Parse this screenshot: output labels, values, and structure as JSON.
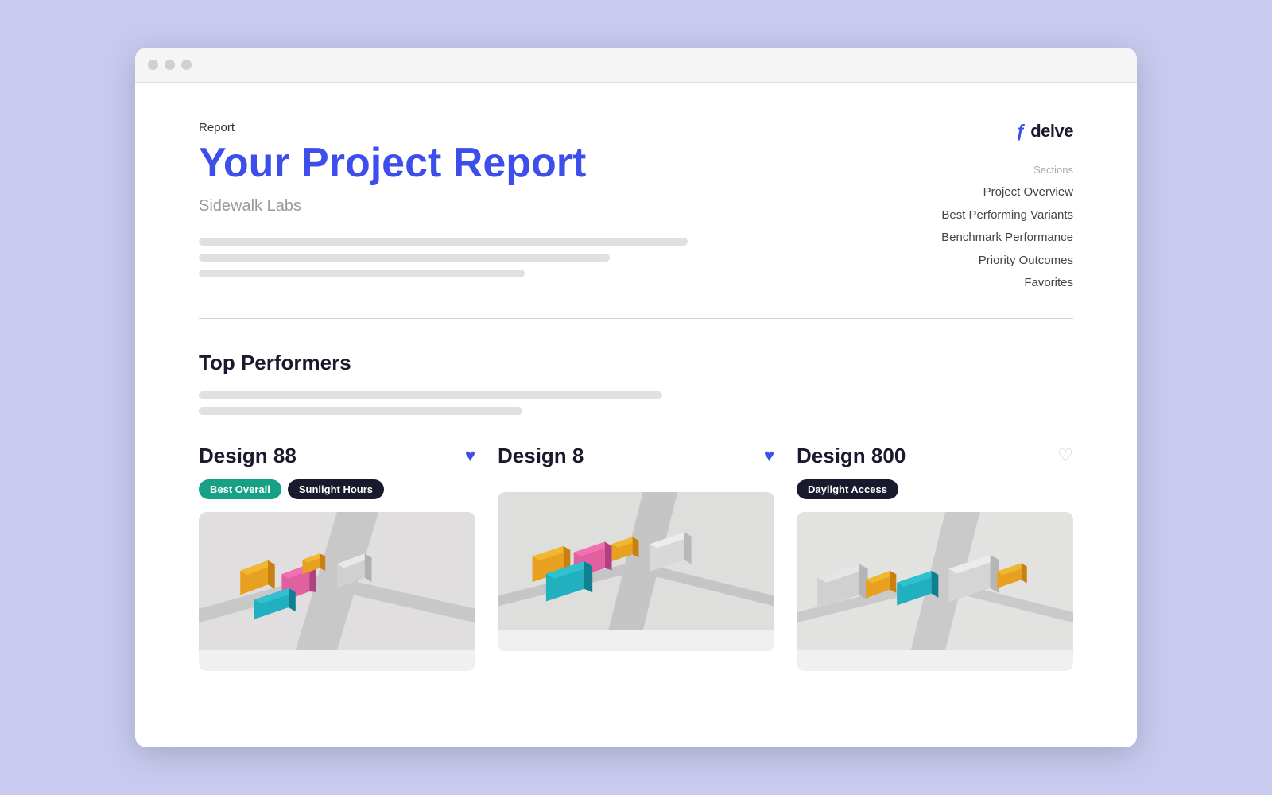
{
  "browser": {
    "dots": [
      "dot1",
      "dot2",
      "dot3"
    ]
  },
  "header": {
    "report_label": "Report",
    "title": "Your Project Report",
    "subtitle": "Sidewalk Labs",
    "logo_icon": "ƒ",
    "logo_text": "delve",
    "sections_label": "Sections",
    "sections": [
      "Project Overview",
      "Best Performing Variants",
      "Benchmark Performance",
      "Priority Outcomes",
      "Favorites"
    ],
    "placeholder_lines": [
      {
        "width": "75%"
      },
      {
        "width": "63%"
      },
      {
        "width": "50%"
      }
    ]
  },
  "top_performers": {
    "heading": "Top Performers",
    "placeholder_lines": [
      {
        "width": "53%"
      },
      {
        "width": "37%"
      }
    ]
  },
  "designs": [
    {
      "name": "Design 88",
      "tags": [
        {
          "label": "Best Overall",
          "style": "green"
        },
        {
          "label": "Sunlight Hours",
          "style": "dark"
        }
      ],
      "heart_filled": true
    },
    {
      "name": "Design 8",
      "tags": [],
      "heart_filled": true
    },
    {
      "name": "Design 800",
      "tags": [
        {
          "label": "Daylight Access",
          "style": "dark"
        }
      ],
      "heart_filled": false
    }
  ],
  "colors": {
    "accent_blue": "#3d4eeb",
    "tag_green": "#16a085",
    "tag_dark": "#1a1a2e"
  }
}
